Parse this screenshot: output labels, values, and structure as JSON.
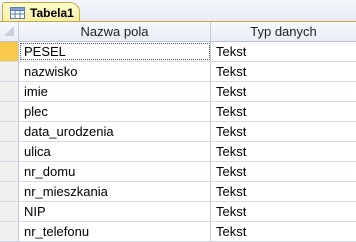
{
  "tab": {
    "label": "Tabela1",
    "icon": "table-icon"
  },
  "columns": {
    "field_name": "Nazwa pola",
    "data_type": "Typ danych"
  },
  "rows": [
    {
      "name": "PESEL",
      "type": "Tekst"
    },
    {
      "name": "nazwisko",
      "type": "Tekst"
    },
    {
      "name": "imie",
      "type": "Tekst"
    },
    {
      "name": "plec",
      "type": "Tekst"
    },
    {
      "name": "data_urodzenia",
      "type": "Tekst"
    },
    {
      "name": "ulica",
      "type": "Tekst"
    },
    {
      "name": "nr_domu",
      "type": "Tekst"
    },
    {
      "name": "nr_mieszkania",
      "type": "Tekst"
    },
    {
      "name": "NIP",
      "type": "Tekst"
    },
    {
      "name": "nr_telefonu",
      "type": "Tekst"
    }
  ],
  "colors": {
    "accent": "#f8c94a",
    "tab_border": "#c9a84a",
    "grid_line": "#d3dbe6"
  }
}
